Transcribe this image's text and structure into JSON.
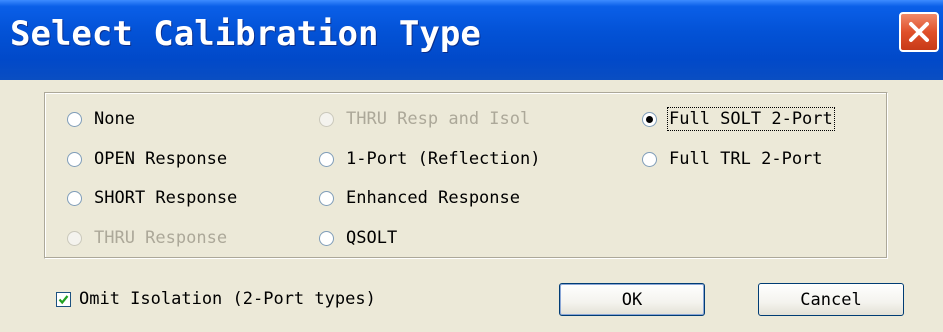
{
  "window": {
    "title": "Select Calibration Type"
  },
  "options": [
    {
      "label": "None",
      "checked": false,
      "enabled": true
    },
    {
      "label": "OPEN Response",
      "checked": false,
      "enabled": true
    },
    {
      "label": "SHORT Response",
      "checked": false,
      "enabled": true
    },
    {
      "label": "THRU Response",
      "checked": false,
      "enabled": false
    },
    {
      "label": "THRU Resp and Isol",
      "checked": false,
      "enabled": false
    },
    {
      "label": "1-Port (Reflection)",
      "checked": false,
      "enabled": true
    },
    {
      "label": "Enhanced Response",
      "checked": false,
      "enabled": true
    },
    {
      "label": "QSOLT",
      "checked": false,
      "enabled": true
    },
    {
      "label": "Full SOLT 2-Port",
      "checked": true,
      "enabled": true
    },
    {
      "label": "Full TRL 2-Port",
      "checked": false,
      "enabled": true
    }
  ],
  "omit_isolation": {
    "label": "Omit Isolation (2-Port types)",
    "checked": true
  },
  "buttons": {
    "ok": "OK",
    "cancel": "Cancel"
  },
  "colors": {
    "titlebar": "#0352d6",
    "close": "#e0502a",
    "dialog_bg": "#ece9d8",
    "disabled_text": "#aca899"
  }
}
